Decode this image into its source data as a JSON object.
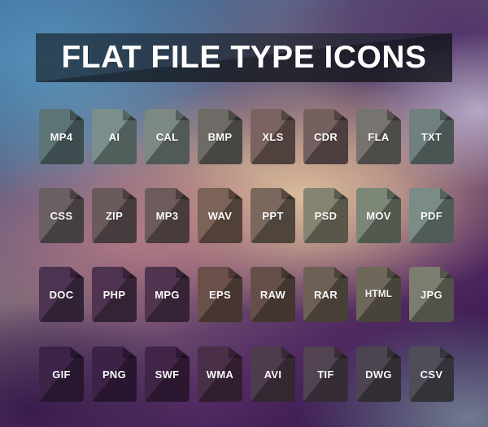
{
  "banner": {
    "title": "FLAT FILE TYPE ICONS",
    "background_color": "#141a20",
    "text_color": "#fdfdfd"
  },
  "background": {
    "style": "blurred mesh gradient",
    "corner_colors": {
      "top_left": "#3d6d9e",
      "top_right": "#4a3566",
      "bottom_left": "#361a4e",
      "bottom_right": "#6b7689"
    },
    "accent_colors": [
      "#e2c49e",
      "#c47c8c",
      "#cec4de",
      "#5696be"
    ]
  },
  "grid": {
    "columns": 8,
    "rows": 4,
    "icon_count": 32,
    "rows_data": [
      {
        "row": 1,
        "icons": [
          {
            "label": "MP4",
            "color": "#5d7477"
          },
          {
            "label": "AI",
            "color": "#7a8f8c"
          },
          {
            "label": "CAL",
            "color": "#7c8884"
          },
          {
            "label": "BMP",
            "color": "#6e6b66"
          },
          {
            "label": "XLS",
            "color": "#7a6360"
          },
          {
            "label": "CDR",
            "color": "#756060"
          },
          {
            "label": "FLA",
            "color": "#77736f"
          },
          {
            "label": "TXT",
            "color": "#6f807e"
          }
        ]
      },
      {
        "row": 2,
        "icons": [
          {
            "label": "CSS",
            "color": "#6a5f63"
          },
          {
            "label": "ZIP",
            "color": "#6a5a5c"
          },
          {
            "label": "MP3",
            "color": "#6d5a5a"
          },
          {
            "label": "WAV",
            "color": "#7c6257"
          },
          {
            "label": "PPT",
            "color": "#7a685c"
          },
          {
            "label": "PSD",
            "color": "#868471"
          },
          {
            "label": "MOV",
            "color": "#7d8778"
          },
          {
            "label": "PDF",
            "color": "#7b8b85"
          }
        ]
      },
      {
        "row": 3,
        "icons": [
          {
            "label": "DOC",
            "color": "#4b3351"
          },
          {
            "label": "PHP",
            "color": "#4e3450"
          },
          {
            "label": "MPG",
            "color": "#513550"
          },
          {
            "label": "EPS",
            "color": "#6a5048"
          },
          {
            "label": "RAW",
            "color": "#655049"
          },
          {
            "label": "RAR",
            "color": "#6e6054"
          },
          {
            "label": "HTML",
            "color": "#6f675a"
          },
          {
            "label": "JPG",
            "color": "#7c7c6f"
          }
        ]
      },
      {
        "row": 4,
        "icons": [
          {
            "label": "GIF",
            "color": "#3d2348"
          },
          {
            "label": "PNG",
            "color": "#3d2248"
          },
          {
            "label": "SWF",
            "color": "#412549"
          },
          {
            "label": "WMA",
            "color": "#4a2f49"
          },
          {
            "label": "AVI",
            "color": "#4d3c4c"
          },
          {
            "label": "TIF",
            "color": "#514352"
          },
          {
            "label": "DWG",
            "color": "#4c4450"
          },
          {
            "label": "CSV",
            "color": "#4f4d58"
          }
        ]
      }
    ]
  }
}
